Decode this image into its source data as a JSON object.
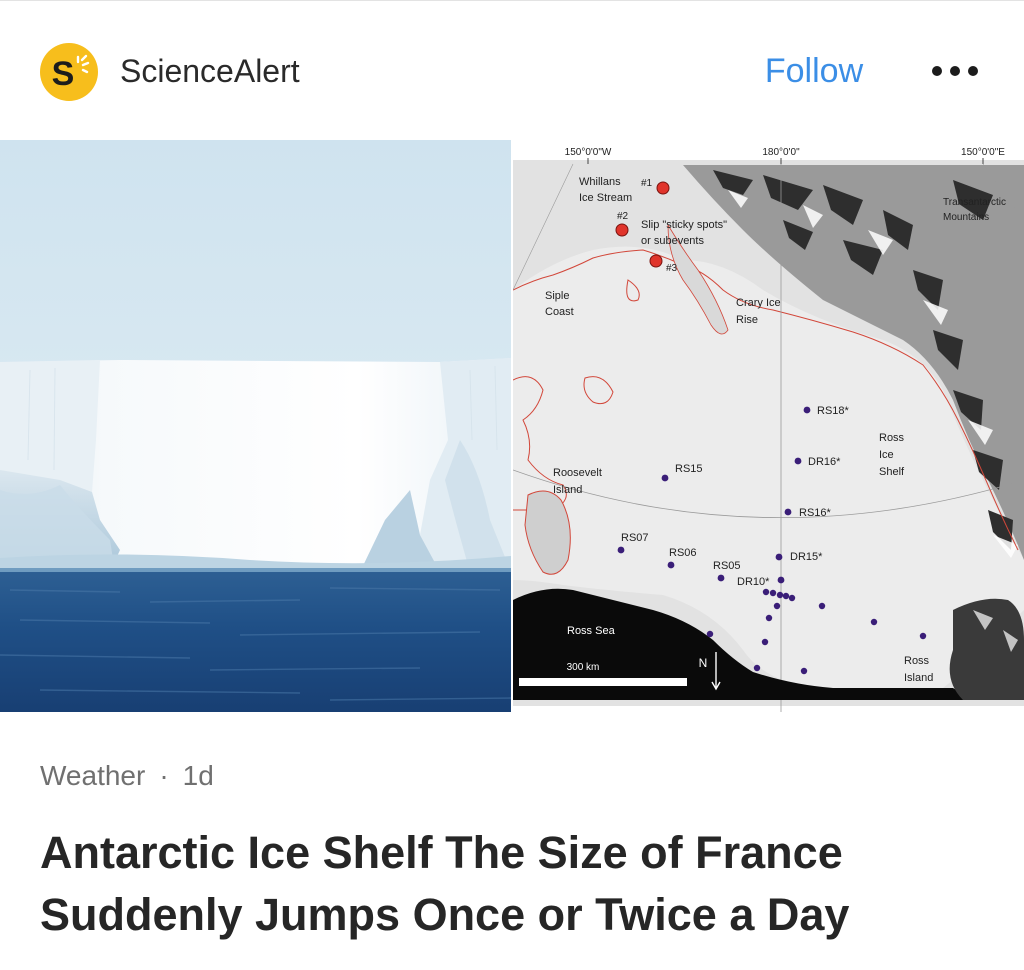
{
  "header": {
    "source_name": "ScienceAlert",
    "logo_letter": "S",
    "follow_label": "Follow",
    "more_icon": "more-horizontal-icon",
    "accent_color": "#3b8ee6",
    "logo_color": "#f7be1c"
  },
  "map": {
    "longitude_labels": [
      "150°0'0\"W",
      "180°0'0\"",
      "150°0'0\"E"
    ],
    "places": {
      "whillans": [
        "Whillans",
        "Ice Stream"
      ],
      "slip": [
        "Slip \"sticky spots\"",
        "or subevents"
      ],
      "siple": [
        "Siple",
        "Coast"
      ],
      "crary": [
        "Crary Ice",
        "Rise"
      ],
      "transantarctic": [
        "Transantarctic",
        "Mountains"
      ],
      "ross_shelf": [
        "Ross",
        "Ice",
        "Shelf"
      ],
      "roosevelt": [
        "Roosevelt",
        "Island"
      ],
      "ross_sea": "Ross Sea",
      "ross_island": [
        "Ross",
        "Island"
      ]
    },
    "events": [
      "#1",
      "#2",
      "#3"
    ],
    "stations": {
      "rs18": "RS18*",
      "dr16": "DR16*",
      "rs15": "RS15",
      "rs16": "RS16*",
      "rs07": "RS07",
      "rs06": "RS06",
      "rs05": "RS05",
      "dr15": "DR15*",
      "dr10": "DR10*"
    },
    "scale_label": "300 km",
    "north_label": "N"
  },
  "article": {
    "category": "Weather",
    "separator": "·",
    "age": "1d",
    "headline": "Antarctic Ice Shelf The Size of France Suddenly Jumps Once or Twice a Day"
  }
}
